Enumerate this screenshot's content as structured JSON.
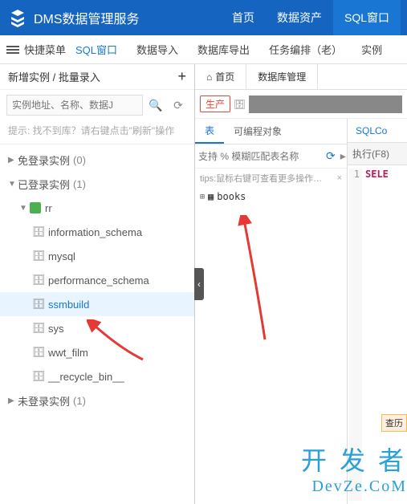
{
  "brand": "DMS数据管理服务",
  "topnav": [
    "首页",
    "数据资产",
    "SQL窗口"
  ],
  "topnav_active": 2,
  "subbar": {
    "quick": "快捷菜单",
    "items": [
      "SQL窗口",
      "数据导入",
      "数据库导出",
      "任务编排（老）",
      "实例"
    ],
    "highlight_index": 0
  },
  "left_header": "新增实例 / 批量录入",
  "search_placeholder": "实例地址、名称、数据J",
  "hint": "提示: 找不到库？请右键点击\"刷新\"操作",
  "tree": {
    "no_login": {
      "label": "免登录实例",
      "count": "(0)"
    },
    "logged": {
      "label": "已登录实例",
      "count": "(1)"
    },
    "unlogged": {
      "label": "未登录实例",
      "count": "(1)"
    },
    "instance": "rr",
    "dbs": [
      "information_schema",
      "mysql",
      "performance_schema",
      "ssmbuild",
      "sys",
      "wwt_film",
      "__recycle_bin__"
    ],
    "selected": "ssmbuild"
  },
  "tabs": {
    "home": "首页",
    "dbmgr": "数据库管理"
  },
  "env_tag": "生产",
  "mid_tabs": [
    "表",
    "可编程对象"
  ],
  "mid_search_placeholder": "支持 % 模糊匹配表名称",
  "mid_tip": "tips:鼠标右键可查看更多操作…",
  "table_name": "books",
  "sql_tab": "SQLCo",
  "exec_label": "执行(F8)",
  "editor": {
    "line": "1",
    "kw": "SELE"
  },
  "watermark": {
    "l1": "开 发 者",
    "l2": "DevZe.CoM"
  },
  "hist": "查历"
}
